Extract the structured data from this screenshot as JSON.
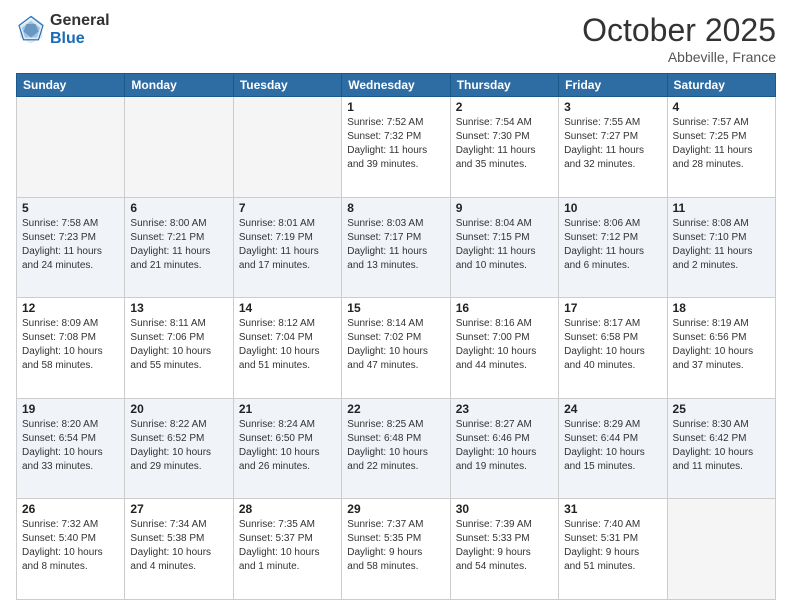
{
  "logo": {
    "general": "General",
    "blue": "Blue"
  },
  "header": {
    "month": "October 2025",
    "location": "Abbeville, France"
  },
  "weekdays": [
    "Sunday",
    "Monday",
    "Tuesday",
    "Wednesday",
    "Thursday",
    "Friday",
    "Saturday"
  ],
  "rows": [
    {
      "shade": "white",
      "days": [
        {
          "num": "",
          "info": ""
        },
        {
          "num": "",
          "info": ""
        },
        {
          "num": "",
          "info": ""
        },
        {
          "num": "1",
          "info": "Sunrise: 7:52 AM\nSunset: 7:32 PM\nDaylight: 11 hours\nand 39 minutes."
        },
        {
          "num": "2",
          "info": "Sunrise: 7:54 AM\nSunset: 7:30 PM\nDaylight: 11 hours\nand 35 minutes."
        },
        {
          "num": "3",
          "info": "Sunrise: 7:55 AM\nSunset: 7:27 PM\nDaylight: 11 hours\nand 32 minutes."
        },
        {
          "num": "4",
          "info": "Sunrise: 7:57 AM\nSunset: 7:25 PM\nDaylight: 11 hours\nand 28 minutes."
        }
      ]
    },
    {
      "shade": "shaded",
      "days": [
        {
          "num": "5",
          "info": "Sunrise: 7:58 AM\nSunset: 7:23 PM\nDaylight: 11 hours\nand 24 minutes."
        },
        {
          "num": "6",
          "info": "Sunrise: 8:00 AM\nSunset: 7:21 PM\nDaylight: 11 hours\nand 21 minutes."
        },
        {
          "num": "7",
          "info": "Sunrise: 8:01 AM\nSunset: 7:19 PM\nDaylight: 11 hours\nand 17 minutes."
        },
        {
          "num": "8",
          "info": "Sunrise: 8:03 AM\nSunset: 7:17 PM\nDaylight: 11 hours\nand 13 minutes."
        },
        {
          "num": "9",
          "info": "Sunrise: 8:04 AM\nSunset: 7:15 PM\nDaylight: 11 hours\nand 10 minutes."
        },
        {
          "num": "10",
          "info": "Sunrise: 8:06 AM\nSunset: 7:12 PM\nDaylight: 11 hours\nand 6 minutes."
        },
        {
          "num": "11",
          "info": "Sunrise: 8:08 AM\nSunset: 7:10 PM\nDaylight: 11 hours\nand 2 minutes."
        }
      ]
    },
    {
      "shade": "white",
      "days": [
        {
          "num": "12",
          "info": "Sunrise: 8:09 AM\nSunset: 7:08 PM\nDaylight: 10 hours\nand 58 minutes."
        },
        {
          "num": "13",
          "info": "Sunrise: 8:11 AM\nSunset: 7:06 PM\nDaylight: 10 hours\nand 55 minutes."
        },
        {
          "num": "14",
          "info": "Sunrise: 8:12 AM\nSunset: 7:04 PM\nDaylight: 10 hours\nand 51 minutes."
        },
        {
          "num": "15",
          "info": "Sunrise: 8:14 AM\nSunset: 7:02 PM\nDaylight: 10 hours\nand 47 minutes."
        },
        {
          "num": "16",
          "info": "Sunrise: 8:16 AM\nSunset: 7:00 PM\nDaylight: 10 hours\nand 44 minutes."
        },
        {
          "num": "17",
          "info": "Sunrise: 8:17 AM\nSunset: 6:58 PM\nDaylight: 10 hours\nand 40 minutes."
        },
        {
          "num": "18",
          "info": "Sunrise: 8:19 AM\nSunset: 6:56 PM\nDaylight: 10 hours\nand 37 minutes."
        }
      ]
    },
    {
      "shade": "shaded",
      "days": [
        {
          "num": "19",
          "info": "Sunrise: 8:20 AM\nSunset: 6:54 PM\nDaylight: 10 hours\nand 33 minutes."
        },
        {
          "num": "20",
          "info": "Sunrise: 8:22 AM\nSunset: 6:52 PM\nDaylight: 10 hours\nand 29 minutes."
        },
        {
          "num": "21",
          "info": "Sunrise: 8:24 AM\nSunset: 6:50 PM\nDaylight: 10 hours\nand 26 minutes."
        },
        {
          "num": "22",
          "info": "Sunrise: 8:25 AM\nSunset: 6:48 PM\nDaylight: 10 hours\nand 22 minutes."
        },
        {
          "num": "23",
          "info": "Sunrise: 8:27 AM\nSunset: 6:46 PM\nDaylight: 10 hours\nand 19 minutes."
        },
        {
          "num": "24",
          "info": "Sunrise: 8:29 AM\nSunset: 6:44 PM\nDaylight: 10 hours\nand 15 minutes."
        },
        {
          "num": "25",
          "info": "Sunrise: 8:30 AM\nSunset: 6:42 PM\nDaylight: 10 hours\nand 11 minutes."
        }
      ]
    },
    {
      "shade": "white",
      "days": [
        {
          "num": "26",
          "info": "Sunrise: 7:32 AM\nSunset: 5:40 PM\nDaylight: 10 hours\nand 8 minutes."
        },
        {
          "num": "27",
          "info": "Sunrise: 7:34 AM\nSunset: 5:38 PM\nDaylight: 10 hours\nand 4 minutes."
        },
        {
          "num": "28",
          "info": "Sunrise: 7:35 AM\nSunset: 5:37 PM\nDaylight: 10 hours\nand 1 minute."
        },
        {
          "num": "29",
          "info": "Sunrise: 7:37 AM\nSunset: 5:35 PM\nDaylight: 9 hours\nand 58 minutes."
        },
        {
          "num": "30",
          "info": "Sunrise: 7:39 AM\nSunset: 5:33 PM\nDaylight: 9 hours\nand 54 minutes."
        },
        {
          "num": "31",
          "info": "Sunrise: 7:40 AM\nSunset: 5:31 PM\nDaylight: 9 hours\nand 51 minutes."
        },
        {
          "num": "",
          "info": ""
        }
      ]
    }
  ]
}
